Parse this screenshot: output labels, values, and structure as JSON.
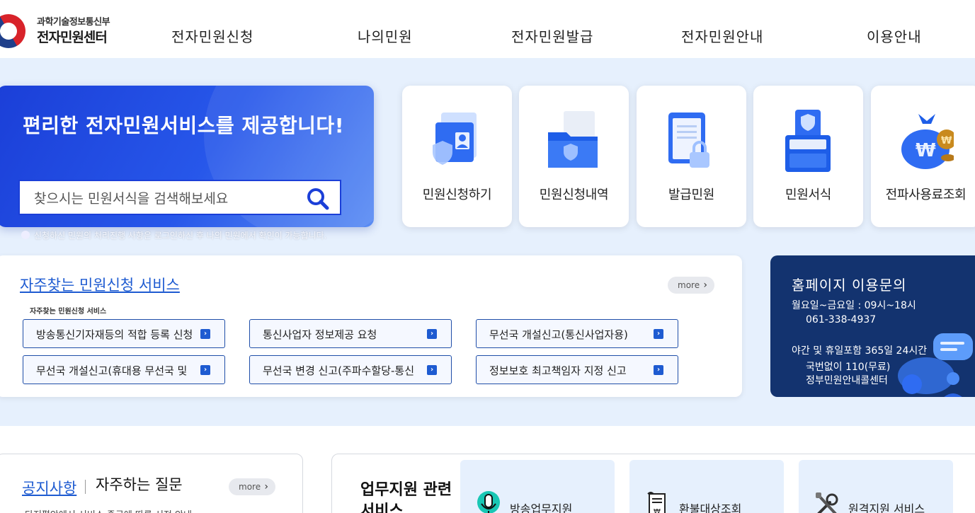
{
  "header": {
    "logo_line1": "과학기술정보통신부",
    "logo_line2": "전자민원센터",
    "nav": [
      "전자민원신청",
      "나의민원",
      "전자민원발급",
      "전자민원안내",
      "이용안내"
    ]
  },
  "hero": {
    "title": "편리한 전자민원서비스를 제공합니다!",
    "search_placeholder": "찾으시는 민원서식을 검색해보세요",
    "notice": "신청하신 민원의 처리진행 사항은 로그인하신 후 나의 민원에서 확인이 가능합니다."
  },
  "quick_menu": [
    {
      "label": "민원신청하기",
      "icon": "document-person-icon"
    },
    {
      "label": "민원신청내역",
      "icon": "folder-shield-icon"
    },
    {
      "label": "발급민원",
      "icon": "clipboard-lock-icon"
    },
    {
      "label": "민원서식",
      "icon": "cabinet-shield-icon"
    },
    {
      "label": "전파사용료조회",
      "icon": "money-bag-icon"
    }
  ],
  "frequent": {
    "title": "자주찾는 민원신청 서비스",
    "subtitle": "자주찾는 민원신청 서비스",
    "more": "more",
    "items": [
      "방송통신기자재등의 적합 등록 신청",
      "통신사업자 정보제공 요청",
      "무선국 개설신고(통신사업자용)",
      "무선국 개설신고(휴대용 무선국 및",
      "무선국 변경 신고(주파수할당-통신",
      "정보보호 최고책임자 지정 신고"
    ]
  },
  "inquiry": {
    "title": "홈페이지 이용문의",
    "hours": "월요일~금요일 : 09시~18시",
    "phone": "061-338-4937",
    "night": "야간 및 휴일포함 365일 24시간",
    "call1": "국번없이 110(무료)",
    "call2": "정부민원안내콜센터"
  },
  "notice_panel": {
    "tab_notice": "공지사항",
    "tab_faq": "자주하는 질문",
    "more": "more",
    "first_line": "다저편안에서 서비스 중국에 따른 서전 안내"
  },
  "work_panel": {
    "title": "업무지원 관련 서비스",
    "items": [
      {
        "label": "방송업무지원",
        "icon": "microphone-icon"
      },
      {
        "label": "환불대상조회",
        "icon": "receipt-won-icon"
      },
      {
        "label": "원격지원 서비스",
        "icon": "tools-icon"
      }
    ]
  },
  "colors": {
    "brand_blue": "#1e5bd1",
    "hero_blue": "#1b3fd8",
    "band_bg": "#e6f0fd",
    "navy": "#13336f"
  }
}
